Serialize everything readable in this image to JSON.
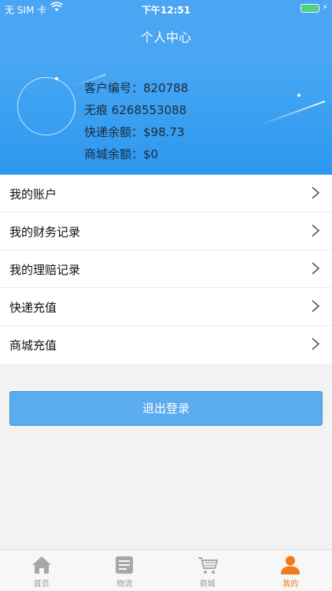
{
  "status_bar": {
    "carrier": "无 SIM 卡",
    "time": "下午12:51"
  },
  "nav": {
    "title": "个人中心"
  },
  "profile": {
    "customer_no": "客户编号：820788",
    "name_phone": "无痕 6268553088",
    "express_balance": "快递余额：$98.73",
    "mall_balance": "商城余额：$0"
  },
  "menu": [
    {
      "label": "我的账户"
    },
    {
      "label": "我的财务记录"
    },
    {
      "label": "我的理赔记录"
    },
    {
      "label": "快递充值"
    },
    {
      "label": "商城充值"
    }
  ],
  "logout_label": "退出登录",
  "tabs": [
    {
      "label": "首页",
      "icon": "home-icon"
    },
    {
      "label": "物流",
      "icon": "logistics-icon"
    },
    {
      "label": "商城",
      "icon": "cart-icon"
    },
    {
      "label": "我的",
      "icon": "person-icon",
      "active": true
    }
  ],
  "colors": {
    "header_blue": "#4aa5f2",
    "button_blue": "#5aabef",
    "tab_active": "#f07b1e",
    "tab_inactive": "#999999"
  }
}
